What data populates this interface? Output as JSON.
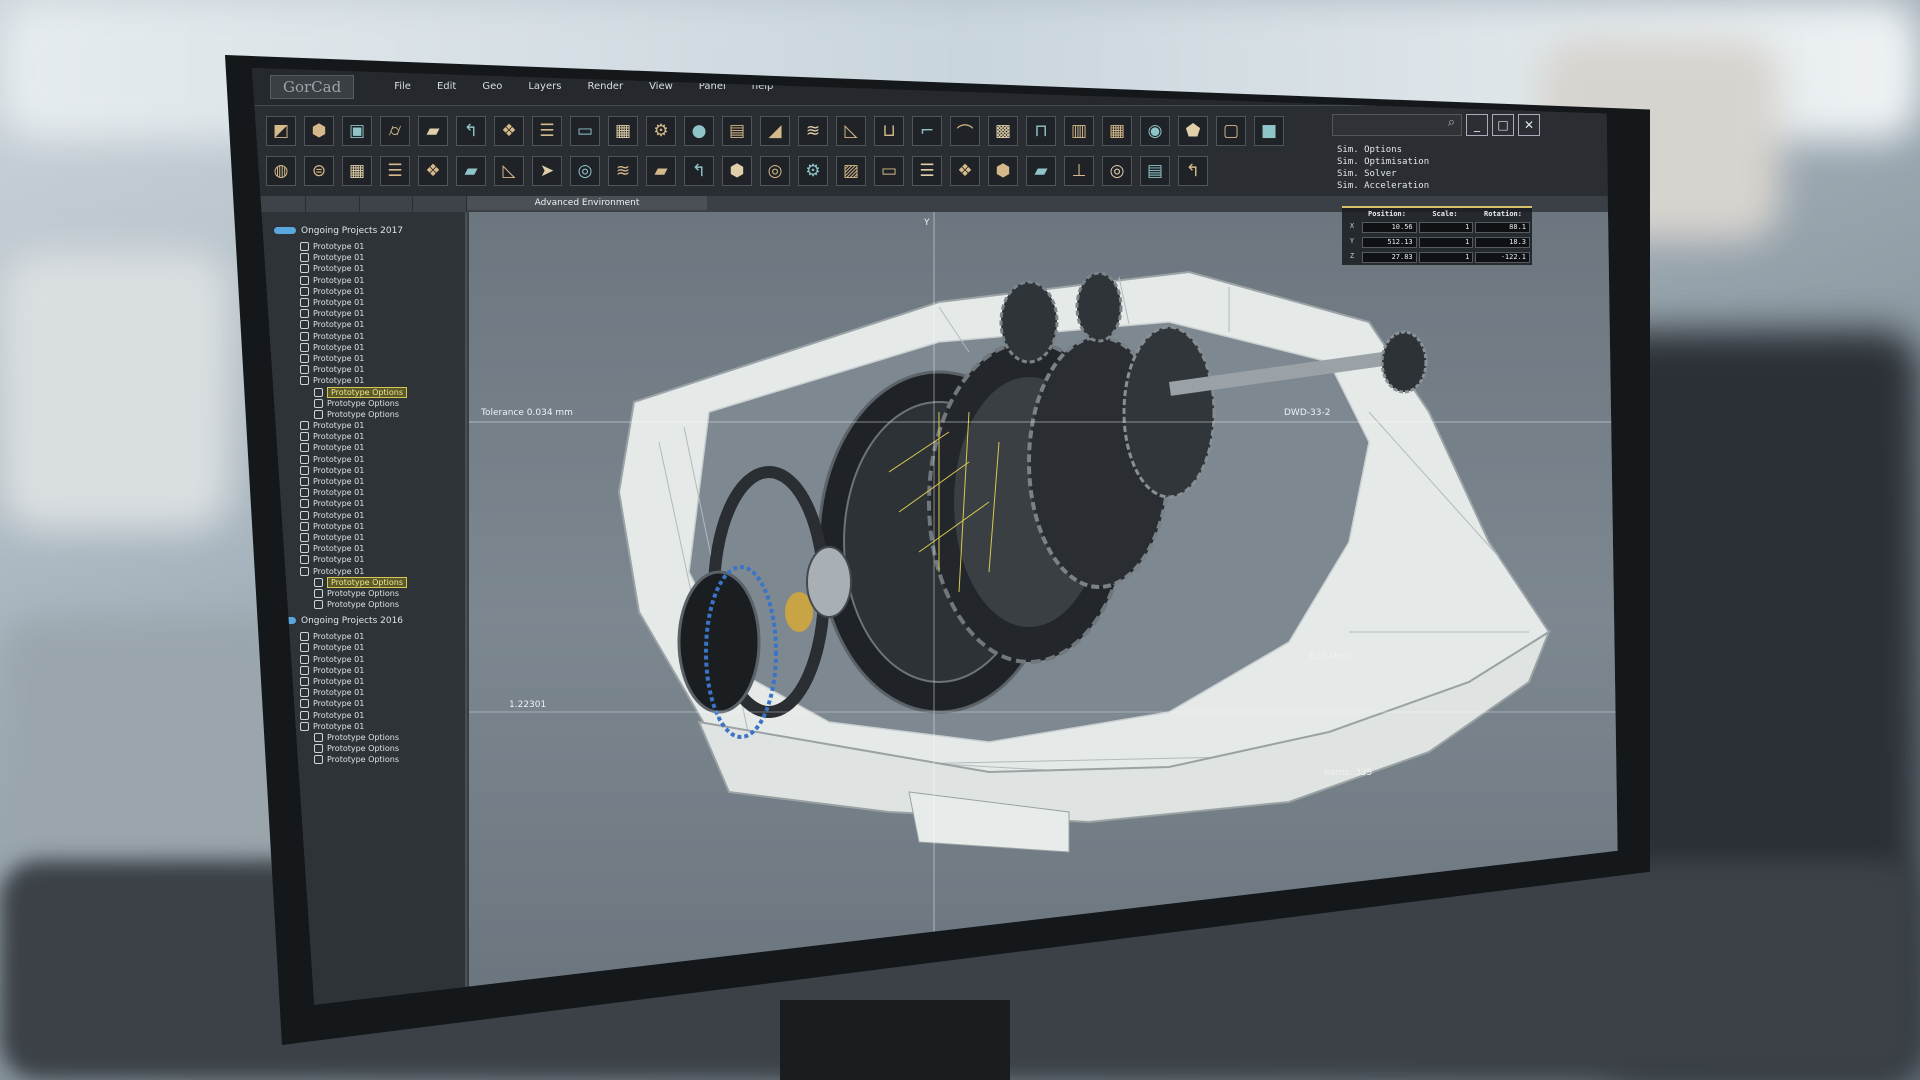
{
  "app": {
    "logo": "GorCad"
  },
  "menu": [
    "File",
    "Edit",
    "Geo",
    "Layers",
    "Render",
    "View",
    "Panel",
    "help"
  ],
  "toolbar": {
    "row1": [
      "shape-icon",
      "cube-icon",
      "box-icon",
      "cylinder-icon",
      "sheet-icon",
      "bend-icon",
      "lattice-icon",
      "stack-icon",
      "folder-icon",
      "grid-icon",
      "gear-icon",
      "circle-icon",
      "panel-icon",
      "wedge-icon",
      "layers-icon",
      "ramp-icon",
      "cup-icon",
      "corner-icon",
      "curve-icon",
      "mesh-icon",
      "notch-icon",
      "tile-icon",
      "grid-icon",
      "sphere-icon",
      "shield-icon",
      "frame-icon"
    ],
    "row2": [
      "block-icon",
      "disc-icon",
      "pipe-icon",
      "grid-icon",
      "stack-icon",
      "lattice-icon",
      "sheet-icon",
      "ramp-icon",
      "arrow-icon",
      "ring-icon",
      "layers-icon",
      "sheet-icon",
      "bend-icon",
      "cube-icon",
      "ring-icon",
      "gear-icon",
      "tiles-icon",
      "folder-icon",
      "stack-icon",
      "lattice-icon",
      "cube-icon",
      "sheet-icon",
      "bolt-icon",
      "ring-icon",
      "panel-icon",
      "bend-icon"
    ]
  },
  "window": {
    "search_glyph": "⌕",
    "minimize": "_",
    "maximize": "□",
    "close": "✕"
  },
  "sim_options": [
    "Sim. Options",
    "Sim. Optimisation",
    "Sim. Solver",
    "Sim. Acceleration"
  ],
  "viewport": {
    "title": "Advanced Environment",
    "axis_label": "Y",
    "tolerance": "Tolerance 0.034 mm",
    "code": "DWD-33-2",
    "edit_mode": "Edit Mode",
    "coordinate": "1.22301",
    "items": "Items: 335"
  },
  "transform": {
    "headers": [
      "Position:",
      "Scale:",
      "Rotation:"
    ],
    "rows": [
      {
        "axis": "X",
        "position": "10.56",
        "scale": "1",
        "rotation": "88.1"
      },
      {
        "axis": "Y",
        "position": "512.13",
        "scale": "1",
        "rotation": "18.3"
      },
      {
        "axis": "Z",
        "position": "27.83",
        "scale": "1",
        "rotation": "-122.1"
      }
    ]
  },
  "tree": {
    "project1": {
      "label": "Ongoing Projects 2017",
      "items": [
        "Prototype 01",
        "Prototype 01",
        "Prototype 01",
        "Prototype 01",
        "Prototype 01",
        "Prototype 01",
        "Prototype 01",
        "Prototype 01",
        "Prototype 01",
        "Prototype 01",
        "Prototype 01",
        "Prototype 01",
        "Prototype 01"
      ],
      "sub_a": [
        "Prototype Options",
        "Prototype Options",
        "Prototype Options"
      ],
      "items_b": [
        "Prototype 01",
        "Prototype 01",
        "Prototype 01",
        "Prototype 01",
        "Prototype 01",
        "Prototype 01",
        "Prototype 01",
        "Prototype 01",
        "Prototype 01",
        "Prototype 01",
        "Prototype 01",
        "Prototype 01",
        "Prototype 01",
        "Prototype 01"
      ],
      "sub_b": [
        "Prototype Options",
        "Prototype Options",
        "Prototype Options"
      ]
    },
    "project2": {
      "label": "Ongoing Projects 2016",
      "items": [
        "Prototype 01",
        "Prototype 01",
        "Prototype 01",
        "Prototype 01",
        "Prototype 01",
        "Prototype 01",
        "Prototype 01",
        "Prototype 01",
        "Prototype 01"
      ],
      "sub": [
        "Prototype Options",
        "Prototype Options",
        "Prototype Options"
      ]
    }
  },
  "colors": {
    "accent_yellow": "#d8c852",
    "root_blue": "#5aa7e0",
    "gear_dark": "#2b2f33",
    "housing": "#e4e8e6"
  }
}
